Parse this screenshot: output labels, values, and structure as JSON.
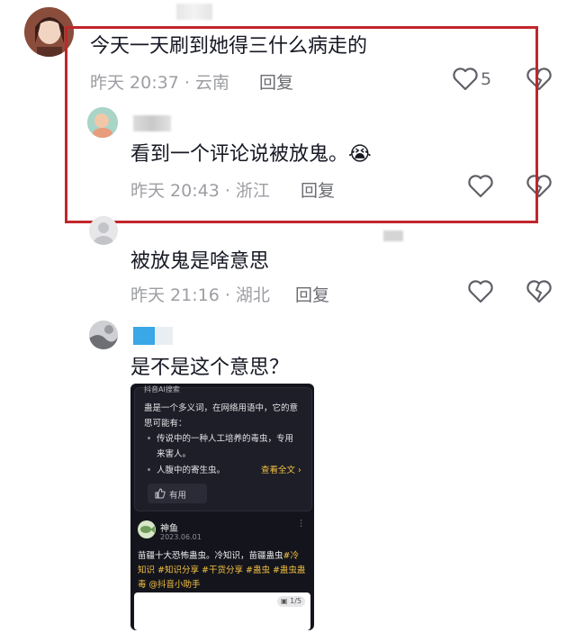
{
  "colors": {
    "highlight_border": "#c0262b",
    "meta_text": "#9d9ea3",
    "tag_yellow": "#f4c142"
  },
  "comments": [
    {
      "text": "今天一天刷到她得三什么病走的",
      "meta": "昨天 20:37 · 云南",
      "reply_label": "回复",
      "like_count": "5",
      "avatar_icon": "user-avatar-icon"
    },
    {
      "text": "看到一个评论说被放鬼。",
      "emoji": "😭",
      "meta": "昨天 20:43 · 浙江",
      "reply_label": "回复",
      "avatar_icon": "user-avatar-icon"
    },
    {
      "text": "被放鬼是啥意思",
      "meta": "昨天 21:16 · 湖北",
      "reply_label": "回复",
      "avatar_icon": "user-avatar-icon"
    },
    {
      "text": "是不是这个意思？",
      "avatar_icon": "user-avatar-icon"
    }
  ],
  "embedded_screenshot": {
    "ai_card": {
      "header": "抖音AI搜索",
      "lines": [
        "蛊是一个多义词，在网络用语中，它的意",
        "思可能有："
      ],
      "bullets": [
        "传说中的一种人工培养的毒虫，专用",
        "来害人。",
        "人腹中的寄生虫。"
      ],
      "view_all": "查看全文 ›",
      "useful_label": "有用"
    },
    "post": {
      "author": "神鱼",
      "date": "2023.06.01",
      "line1_plain": "苗疆十大恐怖蛊虫。冷知识，苗疆蛊虫",
      "line1_tag": "#冷",
      "line2": "知识 #知识分享 #干货分享 #蛊虫 #蛊虫蛊",
      "line3": "毒 @抖音小助手",
      "page_indicator": "1/5"
    }
  }
}
